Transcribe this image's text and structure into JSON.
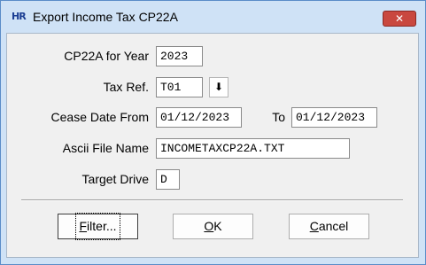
{
  "window": {
    "title": "Export Income Tax CP22A",
    "app_icon_text": "HR",
    "close_glyph": "✕"
  },
  "form": {
    "year_label": "CP22A for Year",
    "year_value": "2023",
    "taxref_label": "Tax Ref.",
    "taxref_value": "T01",
    "taxref_dropdown_glyph": "⬇",
    "cease_from_label": "Cease Date From",
    "cease_from_value": "01/12/2023",
    "cease_to_label": "To",
    "cease_to_value": "01/12/2023",
    "ascii_label": "Ascii File Name",
    "ascii_value": "INCOMETAXCP22A.TXT",
    "drive_label": "Target Drive",
    "drive_value": "D"
  },
  "buttons": {
    "filter_mnemonic": "F",
    "filter_rest": "ilter...",
    "ok_mnemonic": "O",
    "ok_rest": "K",
    "cancel_mnemonic": "C",
    "cancel_rest": "ancel"
  }
}
